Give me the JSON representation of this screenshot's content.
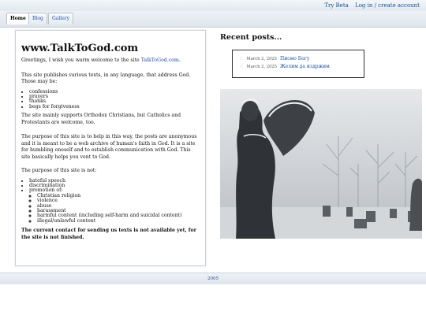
{
  "topbar": {
    "try_beta": "Try Beta",
    "login": "Log in / create account"
  },
  "tabs": [
    {
      "label": "Home"
    },
    {
      "label": "Blog"
    },
    {
      "label": "Gallery"
    }
  ],
  "main": {
    "title": "www.TalkToGod.com",
    "greeting_prefix": "Greetings, I wish you warm welcome to the site ",
    "greeting_link": "TalkToGod.com",
    "greeting_suffix": ".",
    "intro": "This site publishes various texts, in any language, that address God. Those may be:",
    "types": [
      "confessions",
      "prayers",
      "thanks",
      "begs for forgiveness"
    ],
    "support": "The site mainly supports Orthodox Christians, but Catholics and Protestants are welcome, too.",
    "purpose": "The purpose of this site is to help in this way, the posts are anonymous and it is meant to be a web archive of human's faith in God. It is a site for humbling oneself and to establish communication with God. This site basically helps you vent to God.",
    "not_intro": "The purpose of this site is not:",
    "not_items": [
      "hateful speech",
      "discrimination",
      "promotion of:"
    ],
    "promotion_items": [
      "Christian religion",
      "violence",
      "abuse",
      "harassment",
      "harmful content (including self-harm and suicidal content)",
      "illegal/unlawful content"
    ],
    "contact_note": "The current contact for sending us texts is not available yet, for the site is not finished."
  },
  "recent": {
    "title": "Recent posts...",
    "posts": [
      {
        "date": "March 2, 2025",
        "title": "Писмо Богу"
      },
      {
        "date": "March 2, 2025",
        "title": "Желим да издржим"
      }
    ]
  },
  "footer": {
    "year": "2005"
  }
}
